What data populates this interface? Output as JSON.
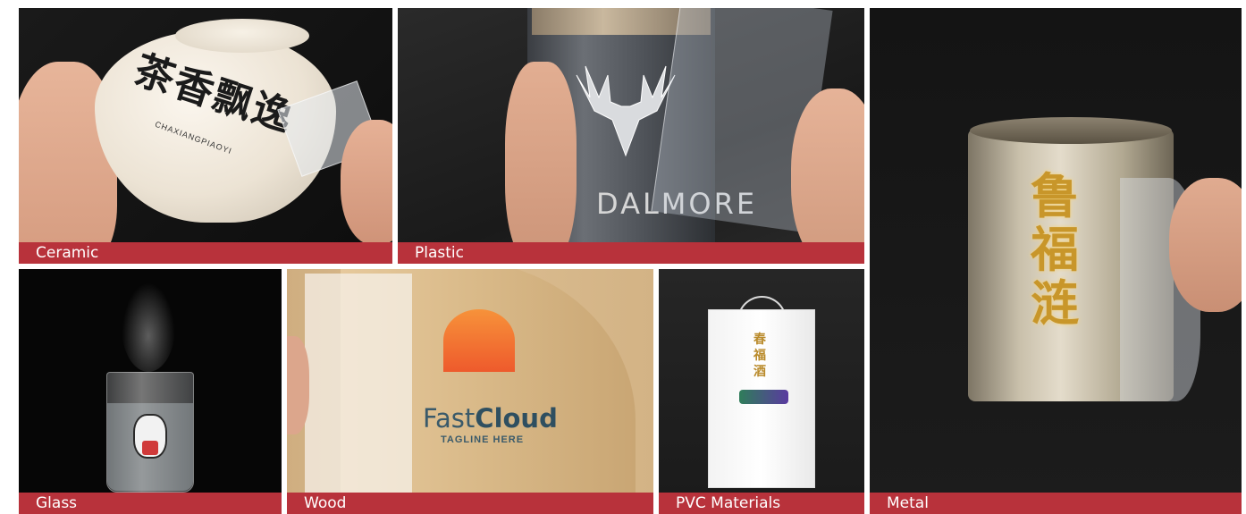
{
  "captions": {
    "ceramic": "Ceramic",
    "plastic": "Plastic",
    "metal": "Metal",
    "glass": "Glass",
    "wood": "Wood",
    "pvc": "PVC Materials"
  },
  "photo_text": {
    "ceramic_brand": "茶香飘逸",
    "ceramic_sub": "CHAXIANGPIAOYI",
    "plastic_brand": "DALMORE",
    "metal_brand": "鲁福涟",
    "wood_brand_left": "Fast",
    "wood_brand_right": "Cloud",
    "wood_tagline": "TAGLINE HERE",
    "pvc_brand": "春福酒"
  },
  "colors": {
    "caption_bg": "#b8323b",
    "caption_text": "#ffffff",
    "page_bg": "#ffffff"
  }
}
